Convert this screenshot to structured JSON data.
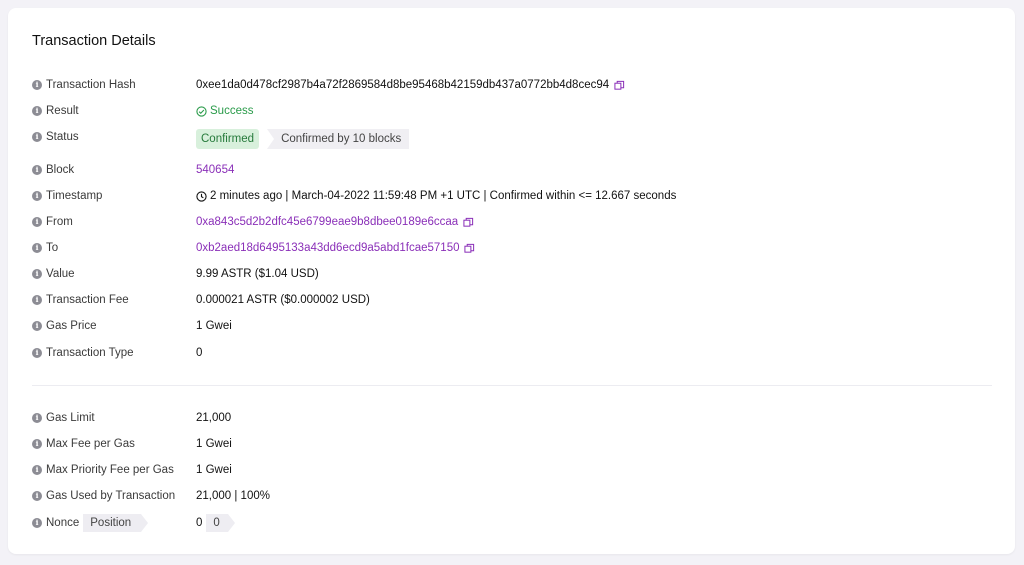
{
  "title": "Transaction Details",
  "rows": {
    "hash": {
      "label": "Transaction Hash",
      "value": "0xee1da0d478cf2987b4a72f2869584d8be95468b42159db437a0772bb4d8cec94"
    },
    "result": {
      "label": "Result",
      "value": "Success"
    },
    "status": {
      "label": "Status",
      "badge": "Confirmed",
      "blocks": "Confirmed by 10 blocks"
    },
    "block": {
      "label": "Block",
      "value": "540654"
    },
    "timestamp": {
      "label": "Timestamp",
      "value": "2 minutes ago | March-04-2022 11:59:48 PM +1 UTC | Confirmed within <= 12.667 seconds"
    },
    "from": {
      "label": "From",
      "value": "0xa843c5d2b2dfc45e6799eae9b8dbee0189e6ccaa"
    },
    "to": {
      "label": "To",
      "value": "0xb2aed18d6495133a43dd6ecd9a5abd1fcae57150"
    },
    "value": {
      "label": "Value",
      "value": "9.99 ASTR ($1.04 USD)"
    },
    "fee": {
      "label": "Transaction Fee",
      "value": "0.000021 ASTR ($0.000002 USD)"
    },
    "gas_price": {
      "label": "Gas Price",
      "value": "1 Gwei"
    },
    "tx_type": {
      "label": "Transaction Type",
      "value": "0"
    },
    "gas_limit": {
      "label": "Gas Limit",
      "value": "21,000"
    },
    "max_fee": {
      "label": "Max Fee per Gas",
      "value": "1 Gwei"
    },
    "max_priority": {
      "label": "Max Priority Fee per Gas",
      "value": "1 Gwei"
    },
    "gas_used": {
      "label": "Gas Used by Transaction",
      "value": "21,000 | 100%"
    },
    "nonce": {
      "label": "Nonce",
      "position_label": "Position",
      "value": "0",
      "position_value": "0"
    }
  },
  "colors": {
    "accent": "#8a2fb8",
    "success": "#2a9b4a",
    "badge_bg": "#d8f0dc"
  }
}
